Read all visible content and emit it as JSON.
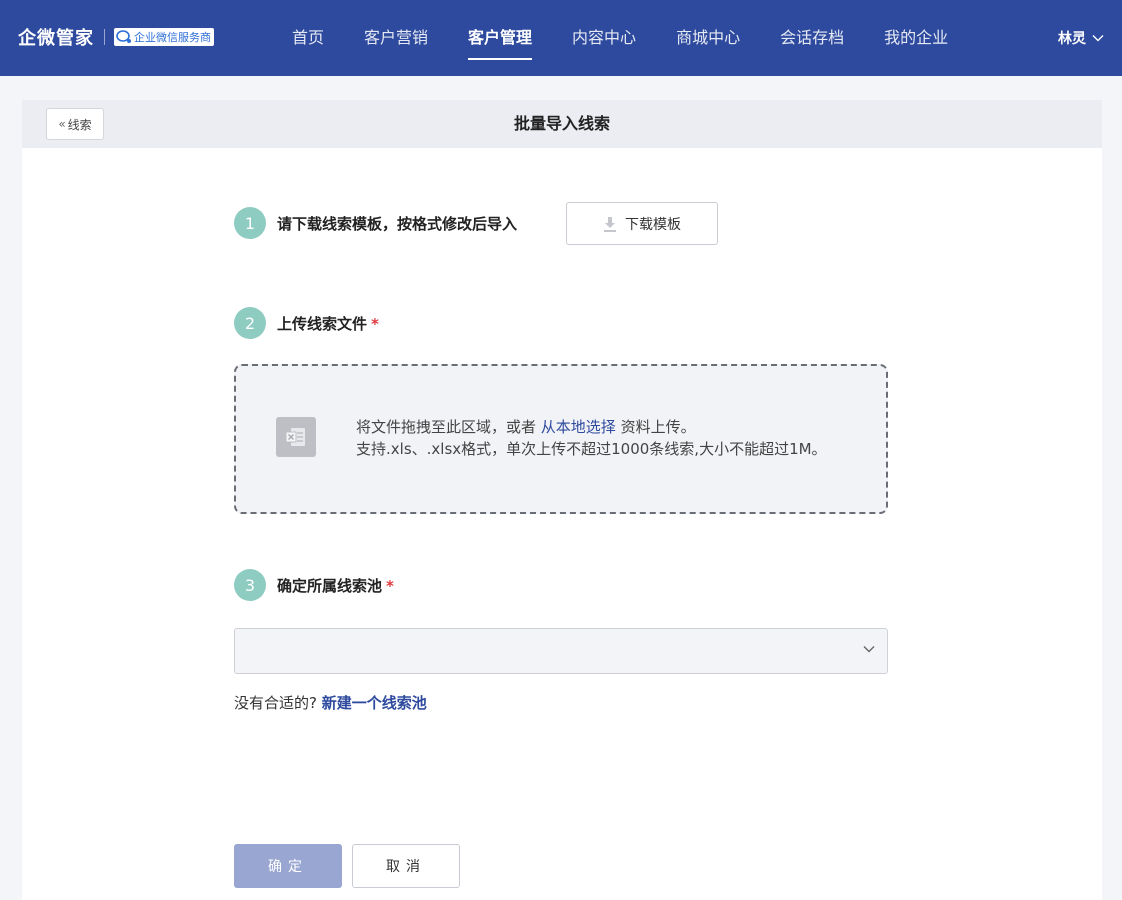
{
  "brand": {
    "name": "企微管家",
    "badge": "企业微信服务商"
  },
  "nav": [
    {
      "label": "首页"
    },
    {
      "label": "客户营销"
    },
    {
      "label": "客户管理",
      "active": true
    },
    {
      "label": "内容中心"
    },
    {
      "label": "商城中心"
    },
    {
      "label": "会话存档"
    },
    {
      "label": "我的企业"
    }
  ],
  "user": {
    "name": "林灵",
    "icon": "chevron-down-icon"
  },
  "page": {
    "back_label": "线索",
    "title": "批量导入线索"
  },
  "step1": {
    "num": "1",
    "label": "请下载线索模板，按格式修改后导入",
    "download_label": "下载模板",
    "icon": "download-icon"
  },
  "step2": {
    "num": "2",
    "label": "上传线索文件",
    "required": "*",
    "drop_text_before": "将文件拖拽至此区域，或者",
    "drop_link": "从本地选择",
    "drop_text_after": "资料上传。",
    "hint": "支持.xls、.xlsx格式，单次上传不超过1000条线索,大小不能超过1M。",
    "icon": "excel-file-icon"
  },
  "step3": {
    "num": "3",
    "label": "确定所属线索池",
    "required": "*",
    "select_value": ""
  },
  "new_pool": {
    "text": "没有合适的?",
    "link": "新建一个线索池"
  },
  "actions": {
    "confirm": "确定",
    "cancel": "取消"
  },
  "colors": {
    "primary": "#2e4a9e",
    "step": "#8ecbc1",
    "confirm_disabled": "#99a6d1",
    "required": "#e0393e"
  }
}
